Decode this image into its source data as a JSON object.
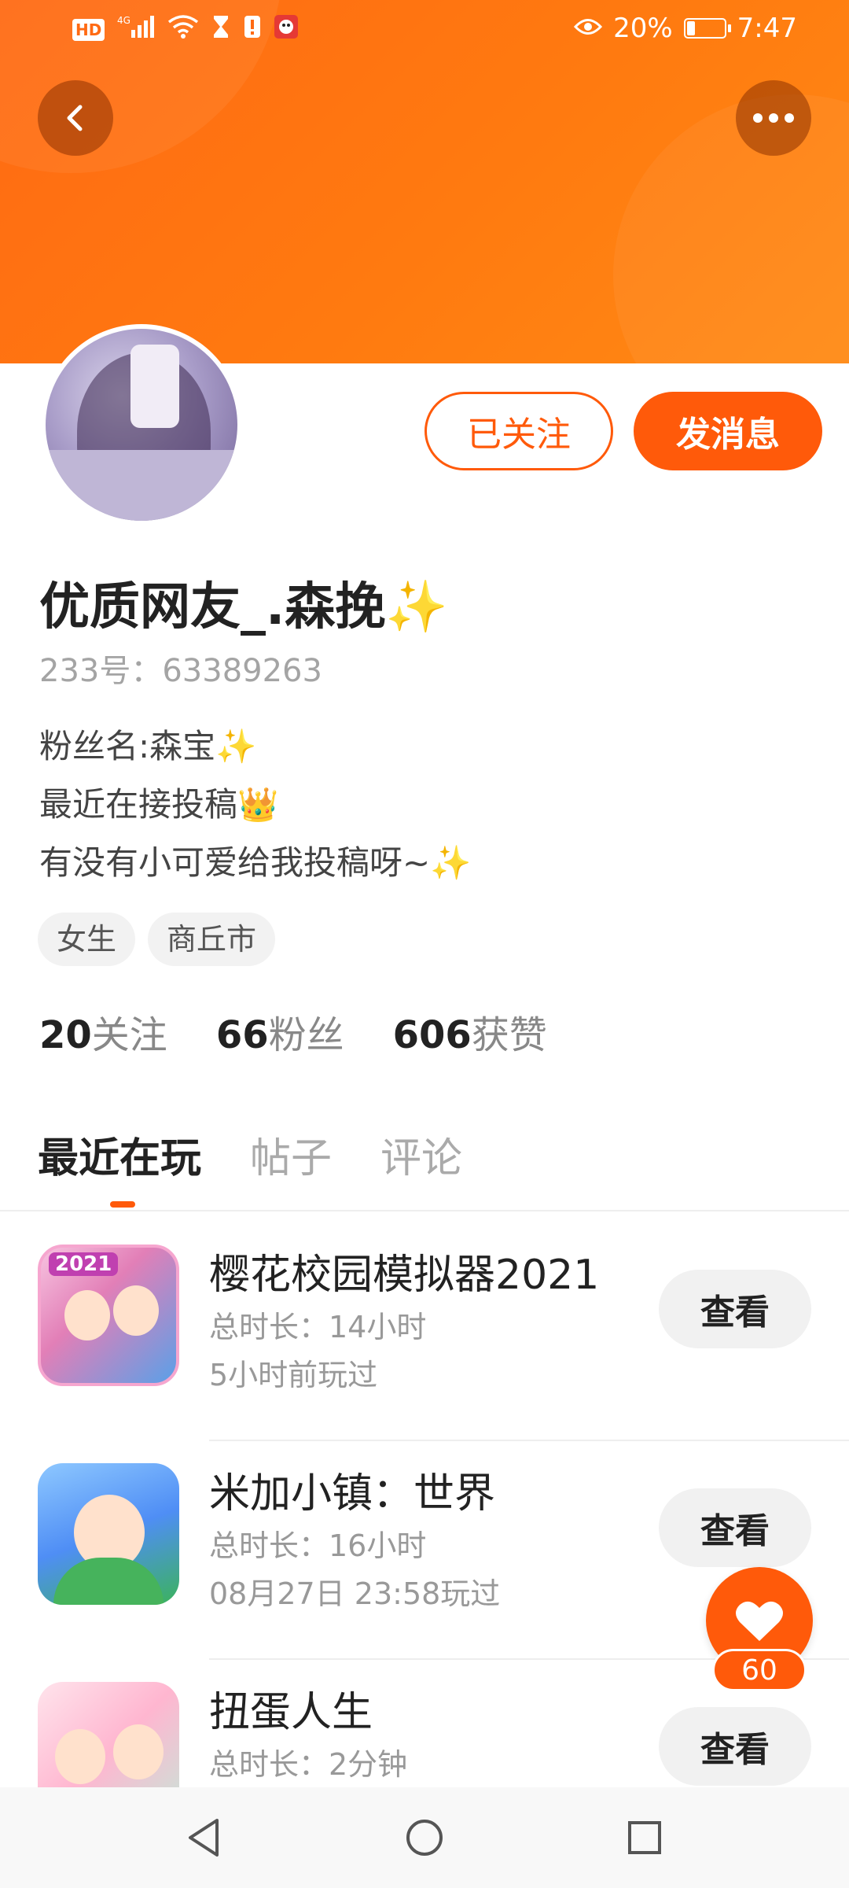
{
  "status_bar": {
    "left_icons": [
      "hd-icon",
      "4g-signal-icon",
      "wifi-icon",
      "hourglass-icon",
      "alert-icon",
      "app-notification-icon"
    ],
    "hd_label": "HD",
    "net_label": "4G",
    "battery_percent": "20%",
    "time": "7:47"
  },
  "header": {
    "back_icon": "chevron-left-icon",
    "more_icon": "more-dots-icon",
    "gradient_from": "#ff6a13",
    "gradient_to": "#ff8a14"
  },
  "profile": {
    "username": "优质网友_.森挽",
    "username_emoji": "✨",
    "user_id": "233号：63389263",
    "bio": [
      {
        "text": "粉丝名:森宝",
        "emoji": "✨"
      },
      {
        "text": "最近在接投稿",
        "emoji": "👑"
      },
      {
        "text": "有没有小可爱给我投稿呀~",
        "emoji": "✨"
      }
    ],
    "tags": [
      "女生",
      "商丘市"
    ],
    "stats": [
      {
        "value": "20",
        "label": "关注"
      },
      {
        "value": "66",
        "label": "粉丝"
      },
      {
        "value": "606",
        "label": "获赞"
      }
    ],
    "follow_label": "已关注",
    "message_label": "发消息"
  },
  "tabs": [
    {
      "label": "最近在玩",
      "active": true
    },
    {
      "label": "帖子",
      "active": false
    },
    {
      "label": "评论",
      "active": false
    }
  ],
  "games": [
    {
      "title": "樱花校园模拟器2021",
      "duration": "总时长：14小时",
      "last_played": "5小时前玩过",
      "view_label": "查看",
      "icon_badge": "2021"
    },
    {
      "title": "米加小镇：世界",
      "duration": "总时长：16小时",
      "last_played": "08月27日 23:58玩过",
      "view_label": "查看",
      "icon_badge": ""
    },
    {
      "title": "扭蛋人生",
      "duration": "总时长：2分钟",
      "last_played": "",
      "view_label": "查看",
      "icon_badge": ""
    }
  ],
  "like_fab": {
    "count": "60"
  },
  "colors": {
    "accent": "#ff5a0a"
  }
}
